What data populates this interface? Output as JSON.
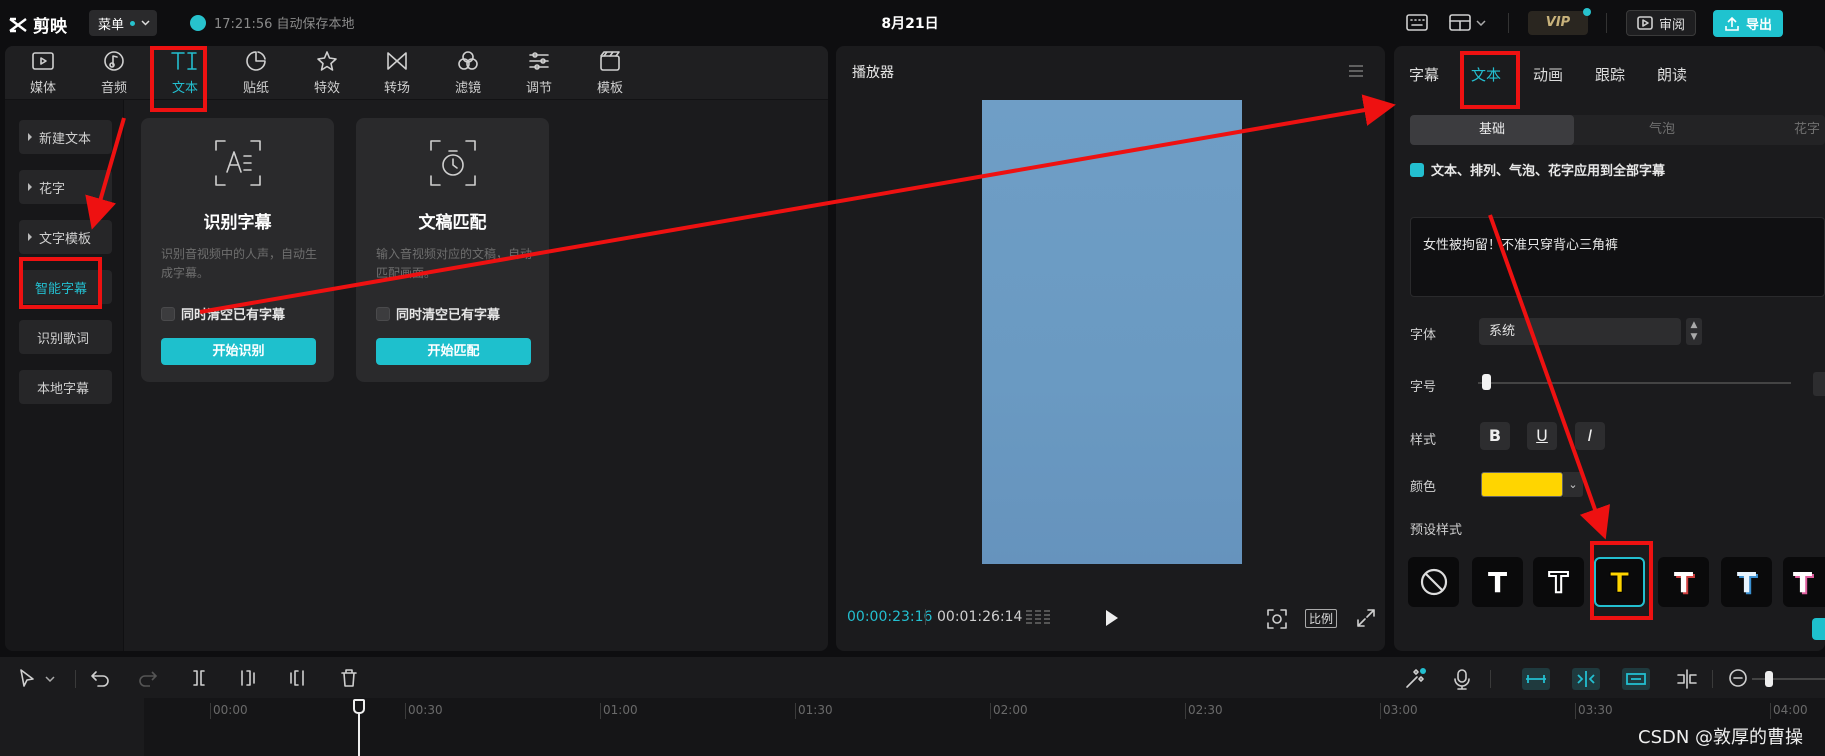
{
  "app": {
    "name": "剪映",
    "menu_label": "菜单",
    "save_status": "17:21:56 自动保存本地",
    "project_title": "8月21日",
    "vip_label": "VIP",
    "review_label": "审阅",
    "export_label": "导出"
  },
  "media_tabs": [
    {
      "label": "媒体",
      "icon": "media-icon"
    },
    {
      "label": "音频",
      "icon": "audio-icon"
    },
    {
      "label": "文本",
      "icon": "text-icon",
      "active": true
    },
    {
      "label": "贴纸",
      "icon": "sticker-icon"
    },
    {
      "label": "特效",
      "icon": "effects-icon"
    },
    {
      "label": "转场",
      "icon": "transition-icon"
    },
    {
      "label": "滤镜",
      "icon": "filter-icon"
    },
    {
      "label": "调节",
      "icon": "adjust-icon"
    },
    {
      "label": "模板",
      "icon": "template-icon"
    }
  ],
  "text_sidebar": [
    "新建文本",
    "花字",
    "文字模板",
    "智能字幕",
    "识别歌词",
    "本地字幕"
  ],
  "cards": [
    {
      "title": "识别字幕",
      "description": "识别音视频中的人声，自动生成字幕。",
      "checkbox": "同时清空已有字幕",
      "button": "开始识别"
    },
    {
      "title": "文稿匹配",
      "description": "输入音视频对应的文稿，自动匹配画面。",
      "checkbox": "同时清空已有字幕",
      "button": "开始匹配"
    }
  ],
  "player": {
    "title": "播放器",
    "current_time": "00:00:23:16",
    "total_time": "00:01:26:14",
    "ratio_label": "比例"
  },
  "inspector": {
    "tabs": [
      "字幕",
      "文本",
      "动画",
      "跟踪",
      "朗读"
    ],
    "active_tab": "文本",
    "subtabs": [
      "基础",
      "气泡",
      "花字"
    ],
    "apply_all": "文本、排列、气泡、花字应用到全部字幕",
    "text_content": "女性被拘留！不准只穿背心三角裤",
    "font_label": "字体",
    "font_value": "系统",
    "size_label": "字号",
    "style_label": "样式",
    "style_buttons": [
      "B",
      "U",
      "I"
    ],
    "color_label": "颜色",
    "color_value": "#ffd500",
    "preset_label": "预设样式"
  },
  "timeline": {
    "ruler_labels": [
      "00:00",
      "00:30",
      "01:00",
      "01:30",
      "02:00",
      "02:30",
      "03:00",
      "03:30",
      "04:00"
    ]
  },
  "watermark": "CSDN @敦厚的曹操",
  "colors": {
    "accent": "#23bfd0",
    "annotation": "#ee1111",
    "preset_selected": "#ffd500"
  }
}
